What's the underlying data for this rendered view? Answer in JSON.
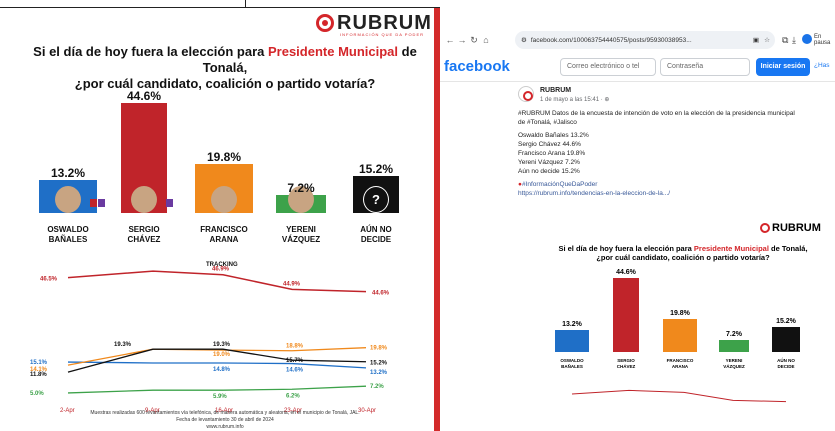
{
  "logo": {
    "brand": "RUBRUM",
    "tagline": "INFORMACIÓN QUE DA PODER"
  },
  "title": {
    "line1_pre": "Si el día de hoy fuera la elección para ",
    "line1_hl": "Presidente Municipal",
    "line1_post": " de Tonalá,",
    "line2": "¿por cuál candidato, coalición o partido votaría?"
  },
  "chart_data": {
    "type": "bar",
    "categories": [
      "OSWALDO BAÑALES",
      "SERGIO CHÁVEZ",
      "FRANCISCO ARANA",
      "YERENI VÁZQUEZ",
      "AÚN NO DECIDE"
    ],
    "values": [
      13.2,
      44.6,
      19.8,
      7.2,
      15.2
    ],
    "labels": [
      "13.2%",
      "44.6%",
      "19.8%",
      "7.2%",
      "15.2%"
    ],
    "colors": [
      "#1f6fc7",
      "#c0242a",
      "#f0891c",
      "#3da24a",
      "#111111"
    ],
    "name_lines": [
      [
        "OSWALDO",
        "BAÑALES"
      ],
      [
        "SERGIO",
        "CHÁVEZ"
      ],
      [
        "FRANCISCO",
        "ARANA"
      ],
      [
        "YERENI",
        "VÁZQUEZ"
      ],
      [
        "AÚN NO",
        "DECIDE"
      ]
    ]
  },
  "tracking": {
    "label": "TRACKING",
    "type": "line",
    "x": [
      "2-Apr",
      "9-Apr",
      "16-Apr",
      "23-Apr",
      "30-Apr"
    ],
    "top_series": {
      "color": "#c0242a",
      "points": [
        46.5,
        null,
        46.9,
        44.9,
        44.6
      ],
      "labels": [
        "46.5%",
        "46.9%",
        "44.9%",
        "44.6%"
      ]
    },
    "bottom_series": [
      {
        "color": "#1f6fc7",
        "points": [
          15.1,
          14.8,
          14.8,
          14.6,
          13.2
        ]
      },
      {
        "color": "#f0891c",
        "points": [
          14.1,
          19.3,
          19.0,
          18.8,
          19.8
        ]
      },
      {
        "color": "#111111",
        "points": [
          11.8,
          19.3,
          19.3,
          15.7,
          15.2
        ]
      },
      {
        "color": "#3da24a",
        "points": [
          5.0,
          5.9,
          5.9,
          6.2,
          7.2
        ]
      }
    ],
    "bottom_labels": [
      "15.1%",
      "14.1%",
      "11.8%",
      "5.0%",
      "19.3%",
      "19.3%",
      "19.0%",
      "15.7%",
      "14.8%",
      "5.9%",
      "18.8%",
      "14.6%",
      "6.2%",
      "19.8%",
      "15.2%",
      "13.2%",
      "7.2%"
    ]
  },
  "footer": {
    "line1": "Muestras realizadas 600 levantamientos vía telefónica, de manera automática y aleatoria, en el municipio de Tonalá, JAL.",
    "line2": "Fecha de levantamiento 30 de abril de 2024",
    "line3": "www.rubrum.info"
  },
  "browser": {
    "url": "facebook.com/100063754440575/posts/95930038953...",
    "profile_label": "En pausa"
  },
  "fb": {
    "logo": "facebook",
    "email_placeholder": "Correo electrónico o tel",
    "password_placeholder": "Contraseña",
    "login_button": "Iniciar sesión",
    "signup_link": "¿Has"
  },
  "post": {
    "author": "RUBRUM",
    "time": "1 de mayo a las 15:41 · ",
    "line1": "#RUBRUM Datos de la encuesta de intención de voto en la elección de la presidencia municipal",
    "line2": "de #Tonalá, #Jalisco",
    "results": [
      "Oswaldo Bañales 13.2%",
      "Sergio Chávez 44.6%",
      "Francisco Arana 19.8%",
      "Yereni Vázquez 7.2%",
      "Aún no decide 15.2%"
    ],
    "hashtag": "#InformaciónQueDaPoder",
    "link": "https://rubrum.info/tendencias-en-la-eleccion-de-la.../"
  }
}
